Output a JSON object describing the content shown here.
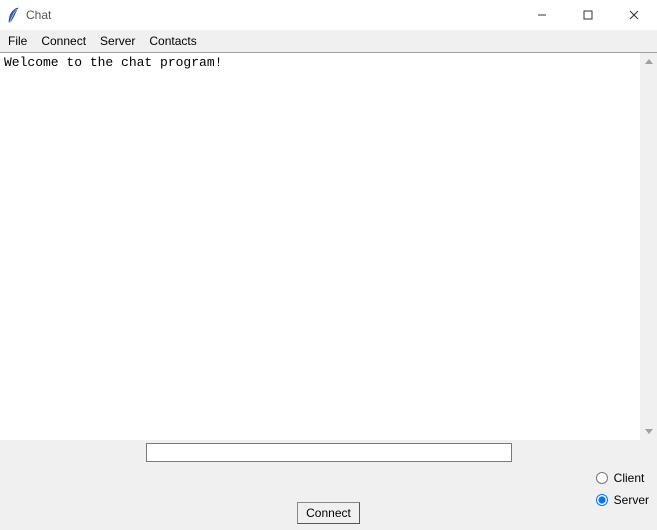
{
  "window": {
    "title": "Chat"
  },
  "menu": {
    "file": "File",
    "connect": "Connect",
    "server": "Server",
    "contacts": "Contacts"
  },
  "chat": {
    "content": "Welcome to the chat program!"
  },
  "input": {
    "value": ""
  },
  "mode": {
    "client_label": "Client",
    "server_label": "Server",
    "selected": "server"
  },
  "buttons": {
    "connect": "Connect"
  }
}
